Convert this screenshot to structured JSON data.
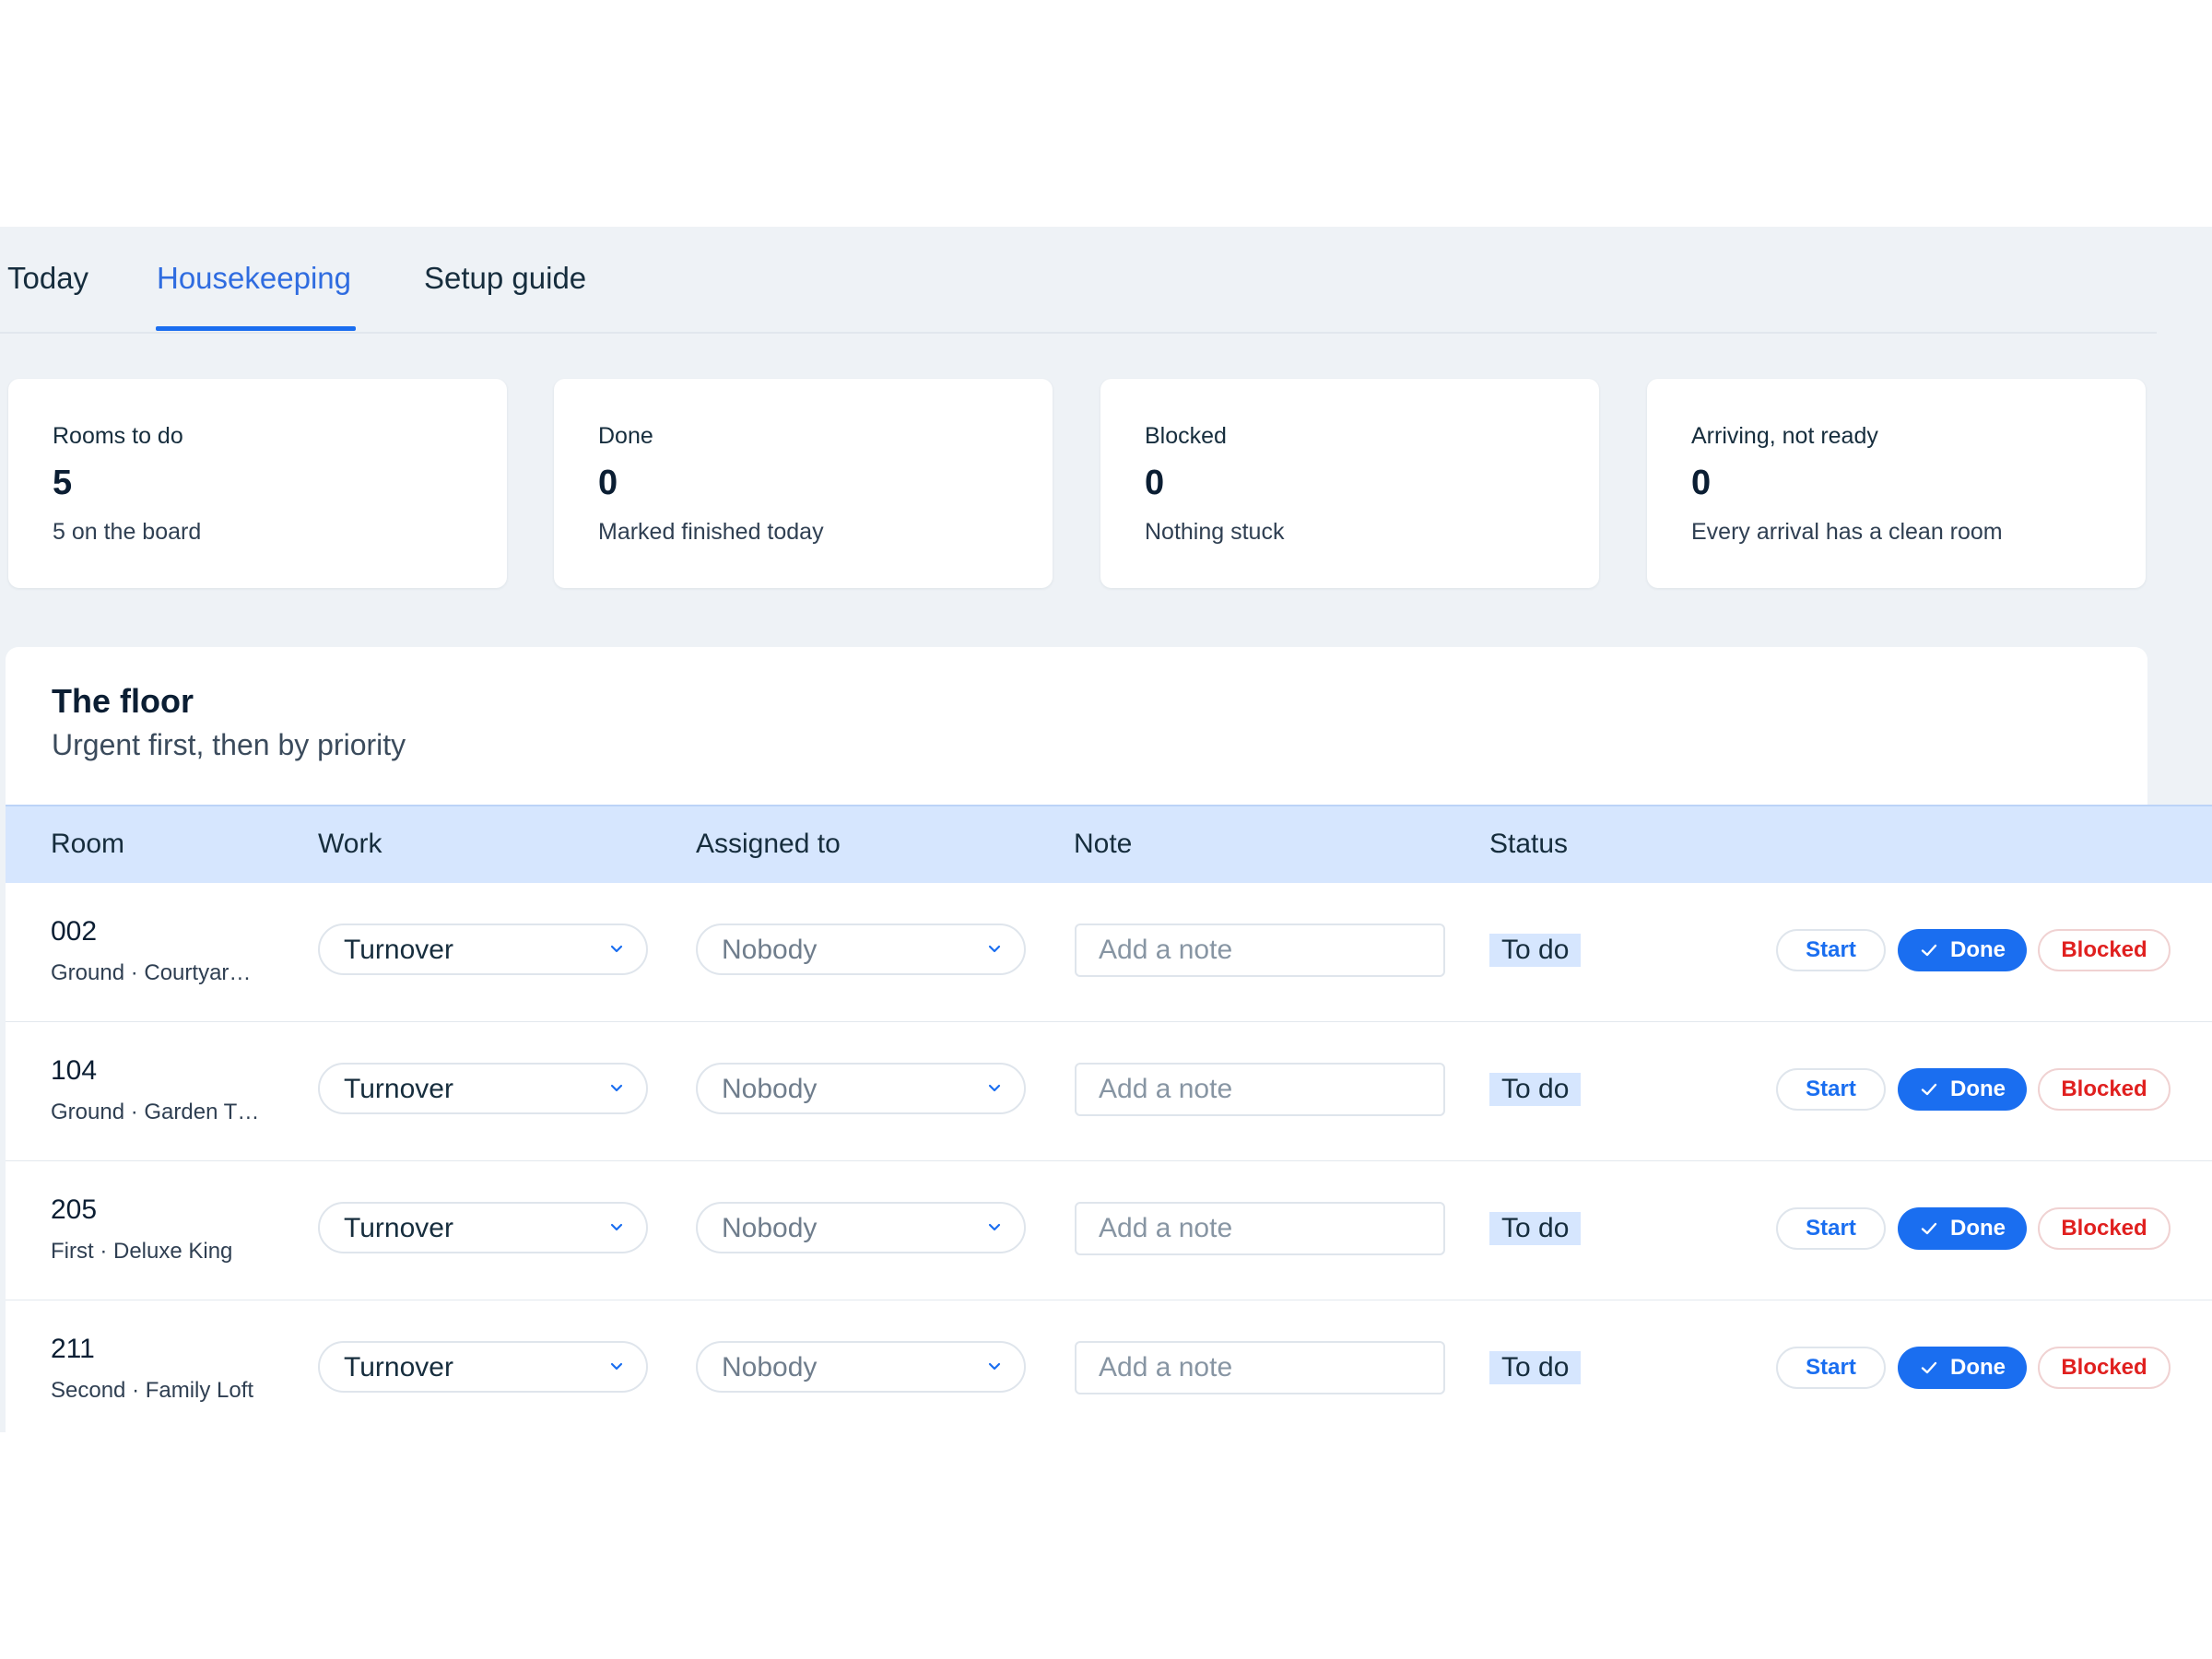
{
  "tabs": [
    {
      "label": "Today",
      "active": false
    },
    {
      "label": "Housekeeping",
      "active": true
    },
    {
      "label": "Setup guide",
      "active": false
    }
  ],
  "stats": [
    {
      "label": "Rooms to do",
      "value": "5",
      "sub": "5 on the board"
    },
    {
      "label": "Done",
      "value": "0",
      "sub": "Marked finished today"
    },
    {
      "label": "Blocked",
      "value": "0",
      "sub": "Nothing stuck"
    },
    {
      "label": "Arriving, not ready",
      "value": "0",
      "sub": "Every arrival has a clean room"
    }
  ],
  "floor": {
    "title": "The floor",
    "subtitle": "Urgent first, then by priority"
  },
  "table": {
    "headers": {
      "room": "Room",
      "work": "Work",
      "assigned": "Assigned to",
      "note": "Note",
      "status": "Status"
    },
    "note_placeholder": "Add a note",
    "actions": {
      "start": "Start",
      "done": "Done",
      "blocked": "Blocked"
    },
    "rows": [
      {
        "room": "002",
        "location": "Ground · Courtyar…",
        "work": "Turnover",
        "assigned": "Nobody",
        "status": "To do"
      },
      {
        "room": "104",
        "location": "Ground · Garden T…",
        "work": "Turnover",
        "assigned": "Nobody",
        "status": "To do"
      },
      {
        "room": "205",
        "location": "First · Deluxe King",
        "work": "Turnover",
        "assigned": "Nobody",
        "status": "To do"
      },
      {
        "room": "211",
        "location": "Second · Family Loft",
        "work": "Turnover",
        "assigned": "Nobody",
        "status": "To do"
      }
    ]
  },
  "colors": {
    "accent": "#1a6ef0",
    "tab_active": "#2f6ce0",
    "header_bg": "#d6e6fe",
    "danger": "#e0201f",
    "page_bg": "#eef2f6"
  },
  "icons": {
    "select_arrow": "chevron-down-icon",
    "done_mark": "check-icon"
  }
}
